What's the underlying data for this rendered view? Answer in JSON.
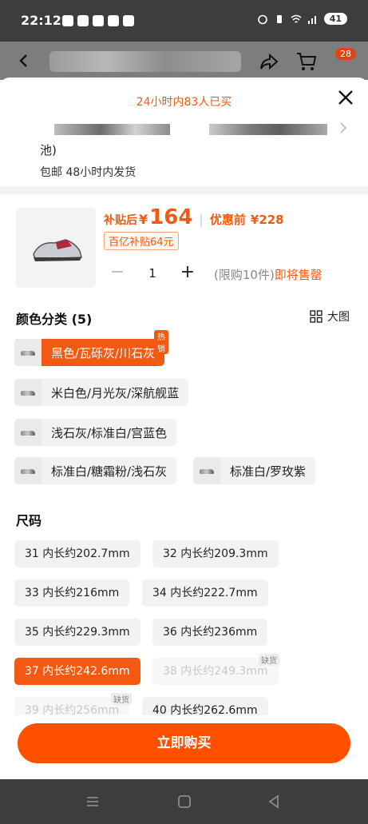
{
  "status_bar": {
    "time": "22:12",
    "battery": "41"
  },
  "header": {
    "cart_badge": "28"
  },
  "sheet": {
    "bought_banner": "24小时内83人已买",
    "address_line2": "池)",
    "shipping": "包邮 48小时内发货",
    "price": {
      "label": "补贴后",
      "currency": "¥",
      "value": "164",
      "before_label": "优惠前",
      "before_value": "¥228"
    },
    "subsidy_tag": "百亿补贴64元",
    "quantity": "1",
    "limit_text": "(限购10件)",
    "limit_hot": "即将售罄",
    "color_section": {
      "title": "颜色分类 (5)",
      "view_label": "大图",
      "hot_tag": "热销",
      "options": [
        "黑色/瓦砾灰/川石灰",
        "米白色/月光灰/深航舰蓝",
        "浅石灰/标准白/宫蓝色",
        "标准白/糖霜粉/浅石灰",
        "标准白/罗玫紫"
      ]
    },
    "size_section": {
      "title": "尺码",
      "out_of_stock": "缺货",
      "options": [
        "31 内长约202.7mm",
        "32 内长约209.3mm",
        "33 内长约216mm",
        "34 内长约222.7mm",
        "35 内长约229.3mm",
        "36 内长约236mm",
        "37 内长约242.6mm",
        "38 内长约249.3mm",
        "39 内长约256mm",
        "40 内长约262.6mm"
      ]
    },
    "buy_button": "立即购买"
  },
  "colors": {
    "accent": "#f25a14",
    "buy_button": "#ff5000"
  }
}
